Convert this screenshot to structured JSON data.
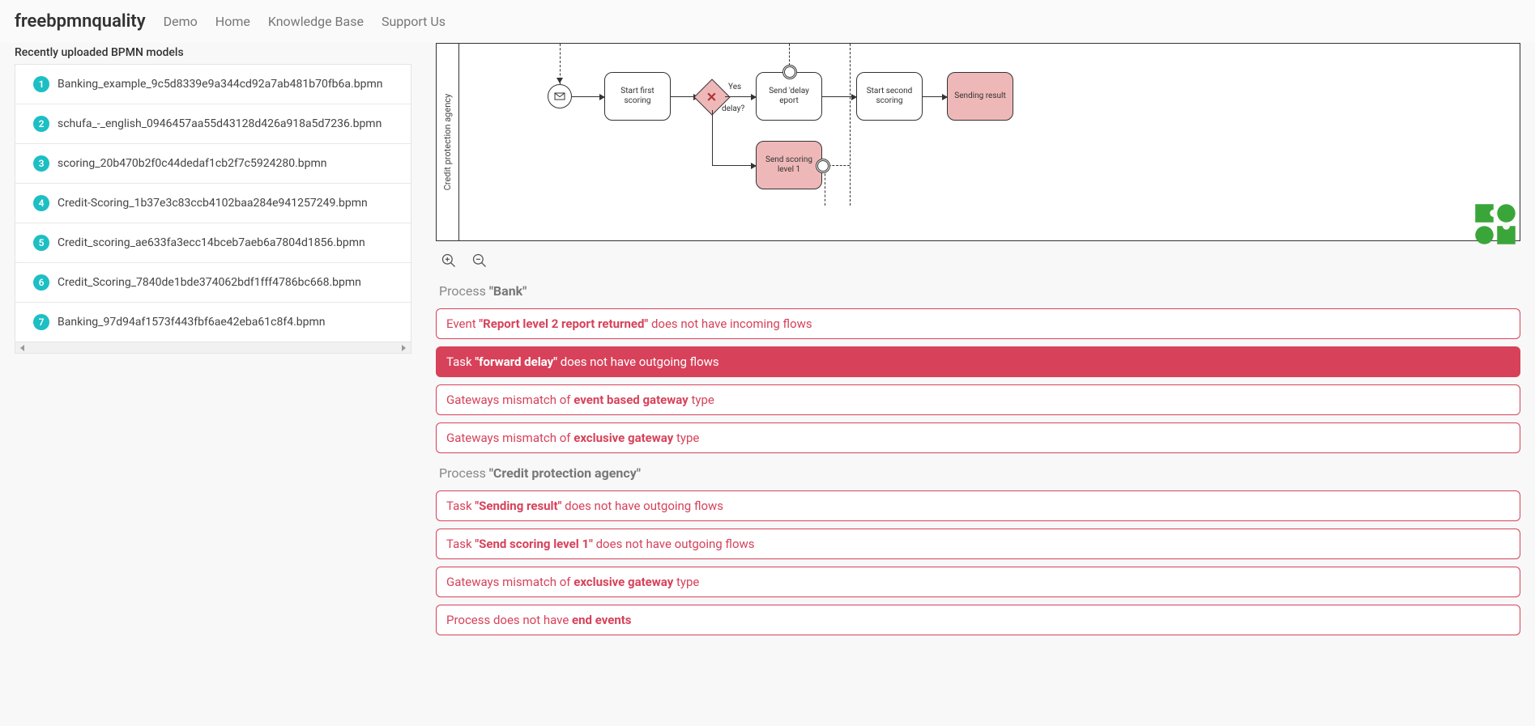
{
  "header": {
    "brand": "freebpmnquality",
    "nav": [
      "Demo",
      "Home",
      "Knowledge Base",
      "Support Us"
    ]
  },
  "sidebar": {
    "title": "Recently uploaded BPMN models",
    "items": [
      "Banking_example_9c5d8339e9a344cd92a7ab481b70fb6a.bpmn",
      "schufa_-_english_0946457aa55d43128d426a918a5d7236.bpmn",
      "scoring_20b470b2f0c44dedaf1cb2f7c5924280.bpmn",
      "Credit-Scoring_1b37e3c83ccb4102baa284e941257249.bpmn",
      "Credit_scoring_ae633fa3ecc14bceb7aeb6a7804d1856.bpmn",
      "Credit_Scoring_7840de1bde374062bdf1fff4786bc668.bpmn",
      "Banking_97d94af1573f443fbf6ae42eba61c8f4.bpmn"
    ]
  },
  "diagram": {
    "pool": "Credit protection agency",
    "task_start_first": "Start first scoring",
    "task_send_delay": "Send 'delay eport",
    "task_start_second": "Start second scoring",
    "task_sending_result": "Sending result",
    "task_send_level1": "Send scoring level 1",
    "gw_yes": "Yes",
    "gw_q": "delay?"
  },
  "results": {
    "proc1_label": "Process ",
    "proc1_name": "\"Bank\"",
    "proc1_issues": [
      {
        "pre": "Event ",
        "bold": "\"Report level 2 report returned\"",
        "post": " does not have incoming flows",
        "active": false
      },
      {
        "pre": "Task ",
        "bold": "\"forward delay\"",
        "post": " does not have outgoing flows",
        "active": true
      },
      {
        "pre": "Gateways mismatch of ",
        "bold": "event based gateway",
        "post": " type",
        "active": false
      },
      {
        "pre": "Gateways mismatch of ",
        "bold": "exclusive gateway",
        "post": " type",
        "active": false
      }
    ],
    "proc2_label": "Process ",
    "proc2_name": "\"Credit protection agency\"",
    "proc2_issues": [
      {
        "pre": "Task ",
        "bold": "\"Sending result\"",
        "post": " does not have outgoing flows",
        "active": false
      },
      {
        "pre": "Task ",
        "bold": "\"Send scoring level 1\"",
        "post": " does not have outgoing flows",
        "active": false
      },
      {
        "pre": "Gateways mismatch of ",
        "bold": "exclusive gateway",
        "post": " type",
        "active": false
      },
      {
        "pre": "Process does not have ",
        "bold": "end events",
        "post": "",
        "active": false
      }
    ]
  }
}
